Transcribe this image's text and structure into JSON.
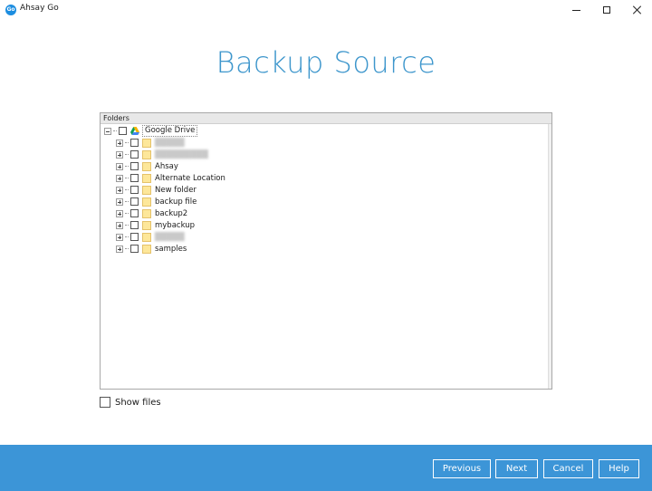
{
  "window": {
    "app_icon_text": "Go",
    "title": "Ahsay Go"
  },
  "page": {
    "title": "Backup Source"
  },
  "tree": {
    "header": "Folders",
    "root": {
      "label": "Google Drive"
    },
    "items": [
      {
        "label": "█████",
        "redacted": true
      },
      {
        "label": "█████████",
        "redacted": true
      },
      {
        "label": "Ahsay",
        "redacted": false
      },
      {
        "label": "Alternate Location",
        "redacted": false
      },
      {
        "label": "New folder",
        "redacted": false
      },
      {
        "label": "backup file",
        "redacted": false
      },
      {
        "label": "backup2",
        "redacted": false
      },
      {
        "label": "mybackup",
        "redacted": false
      },
      {
        "label": "█████",
        "redacted": true
      },
      {
        "label": "samples",
        "redacted": false
      }
    ]
  },
  "options": {
    "show_files_label": "Show files",
    "show_files_checked": false
  },
  "footer": {
    "previous_label": "Previous",
    "next_label": "Next",
    "cancel_label": "Cancel",
    "help_label": "Help"
  },
  "colors": {
    "accent": "#3d96cc",
    "footer_bg": "#3c95d7",
    "folder": "#fde79a"
  }
}
